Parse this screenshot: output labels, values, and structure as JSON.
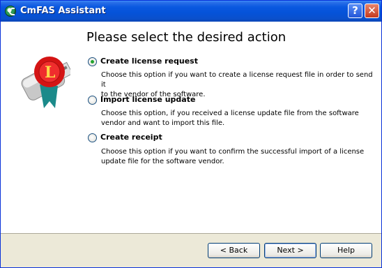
{
  "window": {
    "title": "CmFAS Assistant",
    "help_button": "?",
    "close_button": "✕"
  },
  "heading": "Please select the desired action",
  "options": [
    {
      "label": "Create license request",
      "selected": true,
      "description_lines": [
        "Choose this option if you want to create a license request file in order to send it",
        "to the vendor of the software."
      ]
    },
    {
      "label": "Import license update",
      "selected": false,
      "description_lines": [
        "Choose this option, if you received a license update file from the software",
        "vendor and want to import this file."
      ]
    },
    {
      "label": "Create receipt",
      "selected": false,
      "description_lines": [
        "Choose this option if you want to confirm the successful import of a license",
        "update file for the software vendor."
      ]
    }
  ],
  "buttons": {
    "back": "< Back",
    "next": "Next >",
    "help": "Help"
  },
  "colors": {
    "titlebar": "#0a58e0",
    "selected_radio": "#22a32e",
    "footer": "#ece9d8"
  }
}
